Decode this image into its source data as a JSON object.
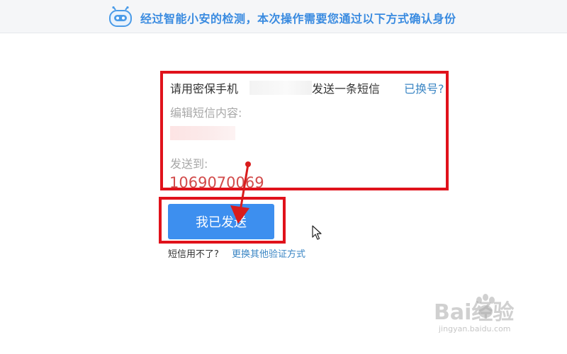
{
  "banner": {
    "icon": "robot-icon",
    "text": "经过智能小安的检测，本次操作需要您通过以下方式确认身份",
    "accent_color": "#3a8be0"
  },
  "verify": {
    "instruction_prefix": "请用密保手机",
    "instruction_suffix": "发送一条短信",
    "change_link": "已换号?",
    "edit_label": "编辑短信内容:",
    "send_to_label": "发送到:",
    "send_to_number": "1069070069",
    "highlight_color": "#e0121b"
  },
  "actions": {
    "confirm_button": "我已发送",
    "unavailable_text": "短信用不了?",
    "switch_method_link": "更换其他验证方式",
    "button_color": "#3d8fef"
  },
  "watermark": {
    "brand": "Bai经验",
    "url": "jingyan.baidu.com"
  }
}
